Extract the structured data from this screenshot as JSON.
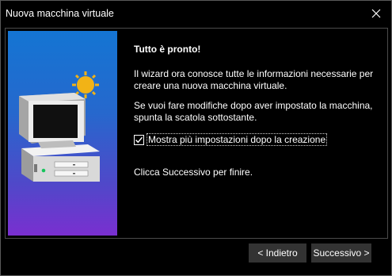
{
  "window": {
    "title": "Nuova macchina virtuale"
  },
  "main": {
    "heading": "Tutto è pronto!",
    "paragraph1": "Il wizard ora conosce tutte le informazioni necessarie per creare una nuova macchina virtuale.",
    "paragraph2": "Se vuoi fare modifiche dopo aver impostato la macchina, spunta la scatola sottostante.",
    "checkbox": {
      "label": "Mostra più impostazioni dopo la creazione",
      "checked": true
    },
    "paragraph3": "Clicca Successivo per finire."
  },
  "buttons": {
    "back": "< Indietro",
    "next": "Successivo >"
  },
  "icons": {
    "close": "close-icon",
    "check": "checkmark-icon",
    "illustration": "computer-illustration"
  },
  "colors": {
    "background": "#000000",
    "button": "#333333",
    "banner_top": "#1475d3",
    "banner_bottom": "#7a2fd0"
  }
}
